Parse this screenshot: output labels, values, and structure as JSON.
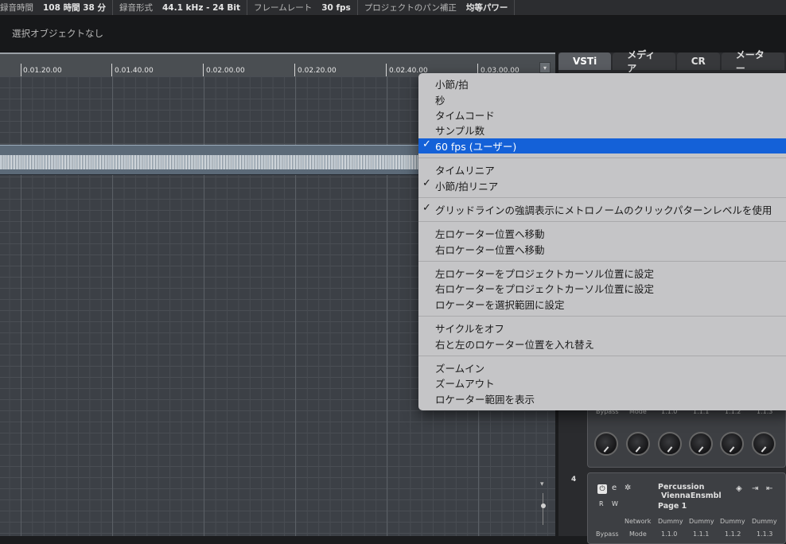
{
  "status_bar": {
    "items": [
      {
        "label": "録音時間",
        "value": "108 時間 38 分"
      },
      {
        "label": "録音形式",
        "value": "44.1 kHz - 24 Bit"
      },
      {
        "label": "フレームレート",
        "value": "30 fps"
      },
      {
        "label": "プロジェクトのパン補正",
        "value": "均等パワー"
      }
    ]
  },
  "info_line": {
    "text": "選択オブジェクトなし"
  },
  "ruler": {
    "ticks": [
      "0.01.20.00",
      "0.01.40.00",
      "0.02.00.00",
      "0.02.20.00",
      "0.02.40.00",
      "0.03.00.00"
    ],
    "menu_button": "▾"
  },
  "right_panel": {
    "tabs": [
      {
        "label": "VSTi",
        "active": true
      },
      {
        "label": "メディア",
        "active": false
      },
      {
        "label": "CR",
        "active": false
      },
      {
        "label": "メーター",
        "active": false
      }
    ],
    "rack_top": {
      "params": [
        "Bypass",
        "Mode",
        "1.1.0",
        "1.1.1",
        "1.1.2",
        "1.1.3"
      ]
    },
    "slot": {
      "number": "4",
      "name_line1": "Percussion",
      "name_line2": "ViennaEnsmbl",
      "page": "Page 1",
      "r_label": "R",
      "w_label": "W",
      "row1": [
        "Network",
        "Dummy",
        "Dummy",
        "Dummy",
        "Dummy"
      ],
      "row2": [
        "Bypass",
        "Mode",
        "1.1.0",
        "1.1.1",
        "1.1.2",
        "1.1.3"
      ]
    }
  },
  "context_menu": {
    "groups": [
      [
        {
          "label": "小節/拍",
          "checked": false
        },
        {
          "label": "秒",
          "checked": false
        },
        {
          "label": "タイムコード",
          "checked": false
        },
        {
          "label": "サンプル数",
          "checked": false
        },
        {
          "label": "60 fps (ユーザー)",
          "checked": true,
          "selected": true
        }
      ],
      [
        {
          "label": "タイムリニア",
          "checked": false
        },
        {
          "label": "小節/拍リニア",
          "checked": true
        }
      ],
      [
        {
          "label": "グリッドラインの強調表示にメトロノームのクリックパターンレベルを使用",
          "checked": true
        }
      ],
      [
        {
          "label": "左ロケーター位置へ移動",
          "checked": false
        },
        {
          "label": "右ロケーター位置へ移動",
          "checked": false
        }
      ],
      [
        {
          "label": "左ロケーターをプロジェクトカーソル位置に設定",
          "checked": false
        },
        {
          "label": "右ロケーターをプロジェクトカーソル位置に設定",
          "checked": false
        },
        {
          "label": "ロケーターを選択範囲に設定",
          "checked": false
        }
      ],
      [
        {
          "label": "サイクルをオフ",
          "checked": false
        },
        {
          "label": "右と左のロケーター位置を入れ替え",
          "checked": false
        }
      ],
      [
        {
          "label": "ズームイン",
          "checked": false
        },
        {
          "label": "ズームアウト",
          "checked": false
        },
        {
          "label": "ロケーター範囲を表示",
          "checked": false
        }
      ]
    ],
    "check_glyph": "✓"
  },
  "colors": {
    "menu_highlight": "#1461d8",
    "menu_background": "#c5c5c7"
  }
}
